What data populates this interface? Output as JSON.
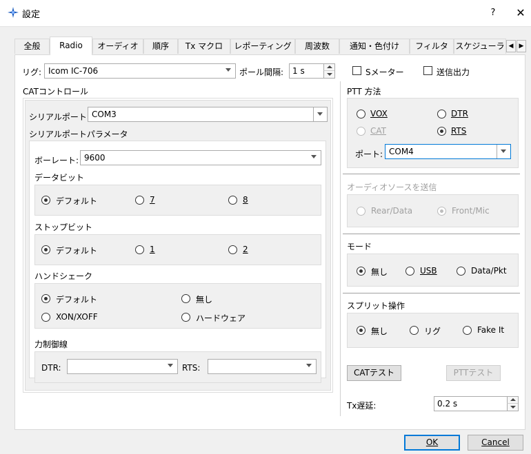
{
  "window": {
    "title": "設定",
    "help": "?",
    "close": "✕"
  },
  "tabs": [
    {
      "label": "全般"
    },
    {
      "label": "Radio"
    },
    {
      "label": "オーディオ"
    },
    {
      "label": "順序"
    },
    {
      "label": "Tx マクロ"
    },
    {
      "label": "レポーティング"
    },
    {
      "label": "周波数"
    },
    {
      "label": "通知・色付け"
    },
    {
      "label": "フィルタ"
    },
    {
      "label": "スケジューラ"
    }
  ],
  "active_tab": "Radio",
  "rig": {
    "label": "リグ:",
    "value": "Icom IC-706"
  },
  "poll": {
    "label": "ポール間隔:",
    "value": "1 s"
  },
  "smeter": {
    "label": "Sメーター",
    "checked": false
  },
  "txpower": {
    "label": "送信出力",
    "checked": false
  },
  "cat": {
    "title": "CATコントロール",
    "serial_port_label": "シリアルポート:",
    "serial_port_value": "COM3",
    "params_title": "シリアルポートパラメータ",
    "baud_label": "ボーレート:",
    "baud_value": "9600",
    "databits_title": "データビット",
    "databits": [
      {
        "label": "デフォルト",
        "selected": true
      },
      {
        "label": "7",
        "selected": false
      },
      {
        "label": "8",
        "selected": false
      }
    ],
    "stopbits_title": "ストップビット",
    "stopbits": [
      {
        "label": "デフォルト",
        "selected": true
      },
      {
        "label": "1",
        "selected": false
      },
      {
        "label": "2",
        "selected": false
      }
    ],
    "handshake_title": "ハンドシェーク",
    "handshake": [
      {
        "label": "デフォルト",
        "selected": true
      },
      {
        "label": "無し",
        "selected": false
      },
      {
        "label": "XON/XOFF",
        "selected": false
      },
      {
        "label": "ハードウェア",
        "selected": false
      }
    ],
    "control_title": "力制御線",
    "dtr_label": "DTR:",
    "dtr_value": "",
    "rts_label": "RTS:",
    "rts_value": ""
  },
  "ptt": {
    "title": "PTT 方法",
    "options": [
      {
        "label": "VOX",
        "selected": false,
        "enabled": true
      },
      {
        "label": "DTR",
        "selected": false,
        "enabled": true
      },
      {
        "label": "CAT",
        "selected": false,
        "enabled": false
      },
      {
        "label": "RTS",
        "selected": true,
        "enabled": true
      }
    ],
    "port_label": "ポート:",
    "port_value": "COM4"
  },
  "audio_source": {
    "title": "オーディオソースを送信",
    "options": [
      {
        "label": "Rear/Data",
        "selected": false
      },
      {
        "label": "Front/Mic",
        "selected": true
      }
    ]
  },
  "mode": {
    "title": "モード",
    "options": [
      {
        "label": "無し",
        "selected": true
      },
      {
        "label": "USB",
        "selected": false
      },
      {
        "label": "Data/Pkt",
        "selected": false
      }
    ]
  },
  "split": {
    "title": "スプリット操作",
    "options": [
      {
        "label": "無し",
        "selected": true
      },
      {
        "label": "リグ",
        "selected": false
      },
      {
        "label": "Fake It",
        "selected": false
      }
    ]
  },
  "buttons": {
    "cat_test": "CATテスト",
    "ptt_test": "PTTテスト",
    "ok": "OK",
    "cancel": "Cancel"
  },
  "tx_delay": {
    "label": "Tx遅延:",
    "value": "0.2 s"
  },
  "colors": {
    "accent": "#0078d7",
    "app_icon": "#1f5fbf"
  }
}
